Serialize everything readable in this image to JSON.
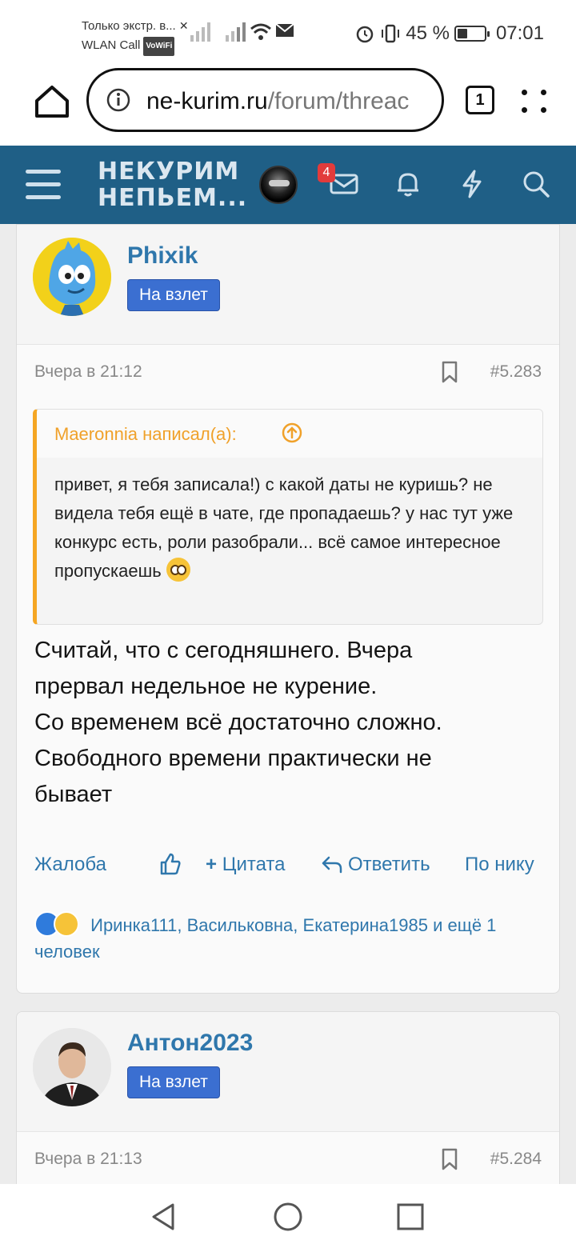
{
  "status_bar": {
    "notification_line1": "Только экстр. в...",
    "notification_line2": "WLAN Call",
    "wifi_badge": "VoWiFi",
    "battery_level_percent": 45,
    "battery": "45 %",
    "time": "07:01"
  },
  "browser": {
    "url_domain": "ne-kurim.ru",
    "url_path": "/forum/threac",
    "tab_count": "1"
  },
  "forum_header": {
    "logo_line1": "НЕКУРИМ",
    "logo_line2": "НЕПЬЕМ...",
    "messages_badge": "4"
  },
  "posts": [
    {
      "username": "Phixik",
      "user_title": "На взлет",
      "date": "Вчера в 21:12",
      "number": "#5.283",
      "quote": {
        "author": "Maeronnia написал(а):",
        "text": "привет, я тебя записала!) с какой даты не куришь? не видела тебя ещё в чате, где пропадаешь? у нас тут уже конкурс есть, роли разобрали... всё самое интересное пропускаешь"
      },
      "body_lines": [
        "Считай, что с сегодняшнего. Вчера",
        "прервал недельное не курение.",
        "Со временем всё достаточно сложно.",
        "Свободного времени практически не",
        "бывает"
      ],
      "actions": {
        "report": "Жалоба",
        "quote": "Цитата",
        "reply": "Ответить",
        "by_nick": "По нику"
      },
      "reactions_text": "Иринка111, Васильковна, Екатерина1985 и ещё 1 человек"
    },
    {
      "username": "Антон2023",
      "user_title": "На взлет",
      "date": "Вчера в 21:13",
      "number": "#5.284"
    }
  ],
  "colors": {
    "header_bg": "#1f5f86",
    "link": "#2f77ac",
    "quote_accent": "#f5a623",
    "user_title_bg": "#3b6fd1",
    "badge": "#e23b3b"
  }
}
